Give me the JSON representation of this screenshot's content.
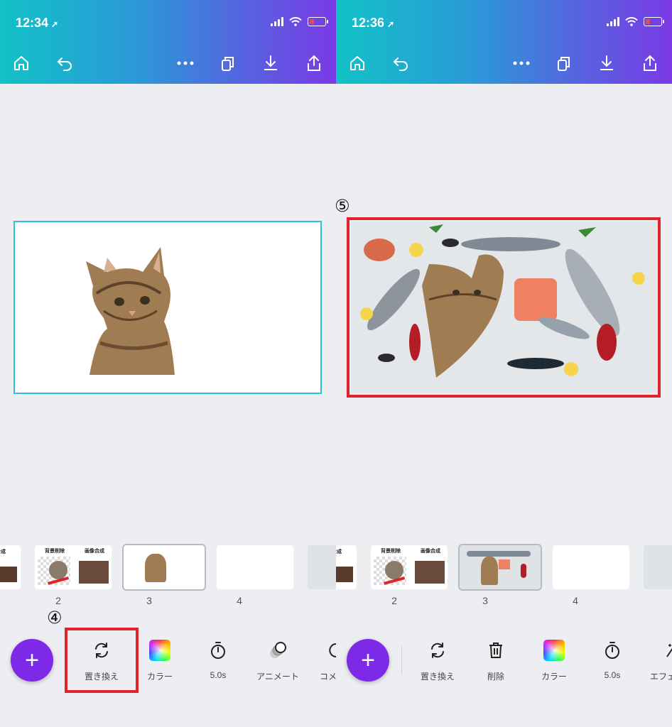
{
  "left": {
    "status": {
      "time": "12:34"
    },
    "pages": [
      {
        "num": "2",
        "title_left": "背景削除",
        "title_right": "画像合成"
      },
      {
        "num": "3"
      },
      {
        "num": "4"
      }
    ],
    "toolbar": [
      {
        "label": "置き換え",
        "icon": "replace-icon"
      },
      {
        "label": "カラー",
        "icon": "color-icon"
      },
      {
        "label": "5.0s",
        "icon": "timer-icon"
      },
      {
        "label": "アニメート",
        "icon": "animate-icon"
      },
      {
        "label": "コメ",
        "icon": "comment-icon"
      }
    ],
    "marker": "④"
  },
  "right": {
    "status": {
      "time": "12:36"
    },
    "pages": [
      {
        "num": "2",
        "title_left": "背景削除",
        "title_right": "画像合成"
      },
      {
        "num": "3"
      },
      {
        "num": "4"
      }
    ],
    "toolbar": [
      {
        "label": "置き換え",
        "icon": "replace-icon"
      },
      {
        "label": "削除",
        "icon": "trash-icon"
      },
      {
        "label": "カラー",
        "icon": "color-icon"
      },
      {
        "label": "5.0s",
        "icon": "timer-icon"
      },
      {
        "label": "エフェ",
        "icon": "effects-icon"
      }
    ],
    "marker": "⑤"
  },
  "colors": {
    "accent": "#7d2ae8",
    "selection": "#2ac4d6",
    "highlight": "#e0242b"
  }
}
